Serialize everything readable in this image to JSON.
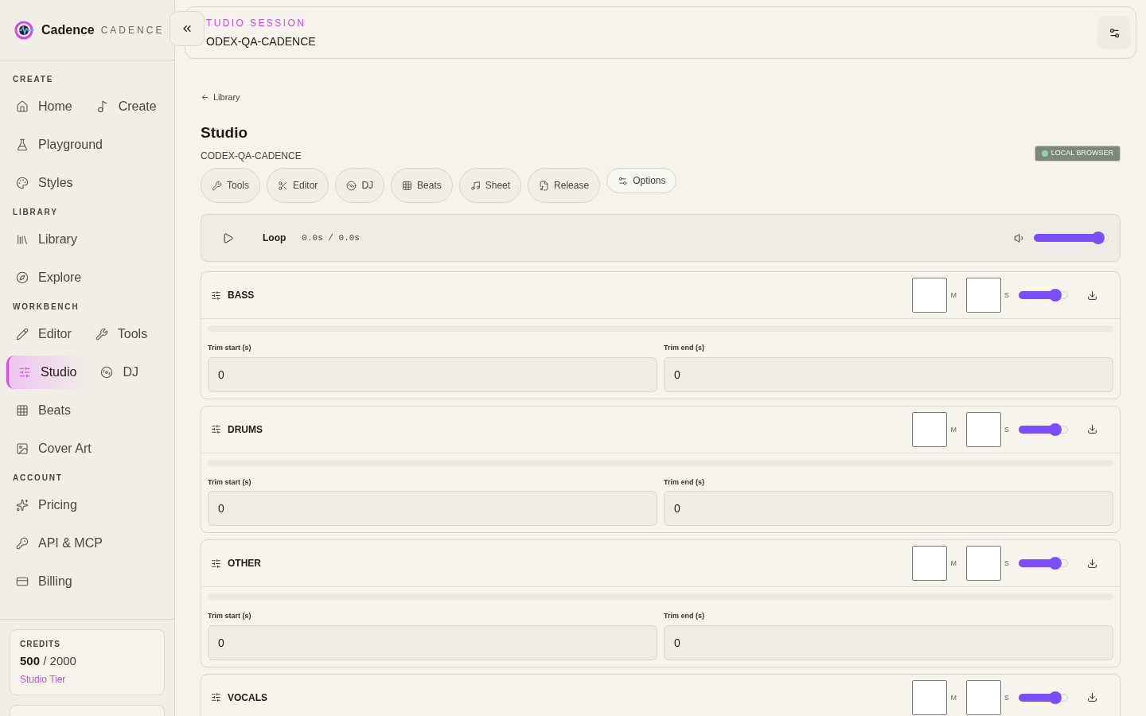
{
  "brand": {
    "name": "Cadence",
    "wordmark": "CADENCE"
  },
  "sidebar": {
    "sections": [
      {
        "title": "CREATE",
        "rows": [
          [
            {
              "label": "Home",
              "selected": false
            },
            {
              "label": "Create",
              "selected": false
            }
          ],
          [
            {
              "label": "Playground",
              "selected": false
            }
          ],
          [
            {
              "label": "Styles",
              "selected": false
            }
          ]
        ]
      },
      {
        "title": "LIBRARY",
        "rows": [
          [
            {
              "label": "Library",
              "selected": false
            }
          ],
          [
            {
              "label": "Explore",
              "selected": false
            }
          ]
        ]
      },
      {
        "title": "WORKBENCH",
        "rows": [
          [
            {
              "label": "Editor",
              "selected": false
            },
            {
              "label": "Tools",
              "selected": false
            }
          ],
          [
            {
              "label": "Studio",
              "selected": true
            },
            {
              "label": "DJ",
              "selected": false
            }
          ],
          [
            {
              "label": "Beats",
              "selected": false
            }
          ],
          [
            {
              "label": "Cover Art",
              "selected": false
            }
          ]
        ]
      },
      {
        "title": "ACCOUNT",
        "rows": [
          [
            {
              "label": "Pricing",
              "selected": false
            }
          ],
          [
            {
              "label": "API & MCP",
              "selected": false
            }
          ],
          [
            {
              "label": "Billing",
              "selected": false
            }
          ]
        ]
      }
    ],
    "credits": {
      "title": "CREDITS",
      "used": "500",
      "total": "/ 2000",
      "tier": "Studio Tier"
    }
  },
  "header": {
    "eyebrow": "TUDIO SESSION",
    "session": "ODEX-QA-CADENCE"
  },
  "back_link": "Library",
  "page": {
    "title": "Studio",
    "subtitle": "CODEX-QA-CADENCE",
    "badge": "LOCAL BROWSER"
  },
  "tool_buttons": [
    {
      "label": "Tools"
    },
    {
      "label": "Editor"
    },
    {
      "label": "DJ"
    },
    {
      "label": "Beats"
    },
    {
      "label": "Sheet"
    },
    {
      "label": "Release"
    },
    {
      "label": "Options"
    }
  ],
  "transport": {
    "loop": "Loop",
    "time": "0.0s / 0.0s",
    "volume": {
      "level": 0.9
    }
  },
  "tracks": [
    {
      "name": "BASS",
      "mute_label": "M",
      "solo_label": "S",
      "muted": false,
      "solo": false,
      "level": 0.8,
      "trim_start_label": "Trim start (s)",
      "trim_start": "0",
      "trim_end_label": "Trim end (s)",
      "trim_end": "0"
    },
    {
      "name": "DRUMS",
      "mute_label": "M",
      "solo_label": "S",
      "muted": false,
      "solo": false,
      "level": 0.8,
      "trim_start_label": "Trim start (s)",
      "trim_start": "0",
      "trim_end_label": "Trim end (s)",
      "trim_end": "0"
    },
    {
      "name": "OTHER",
      "mute_label": "M",
      "solo_label": "S",
      "muted": false,
      "solo": false,
      "level": 0.8,
      "trim_start_label": "Trim start (s)",
      "trim_start": "0",
      "trim_end_label": "Trim end (s)",
      "trim_end": "0"
    },
    {
      "name": "VOCALS",
      "mute_label": "M",
      "solo_label": "S",
      "muted": false,
      "solo": false,
      "level": 0.8
    }
  ]
}
